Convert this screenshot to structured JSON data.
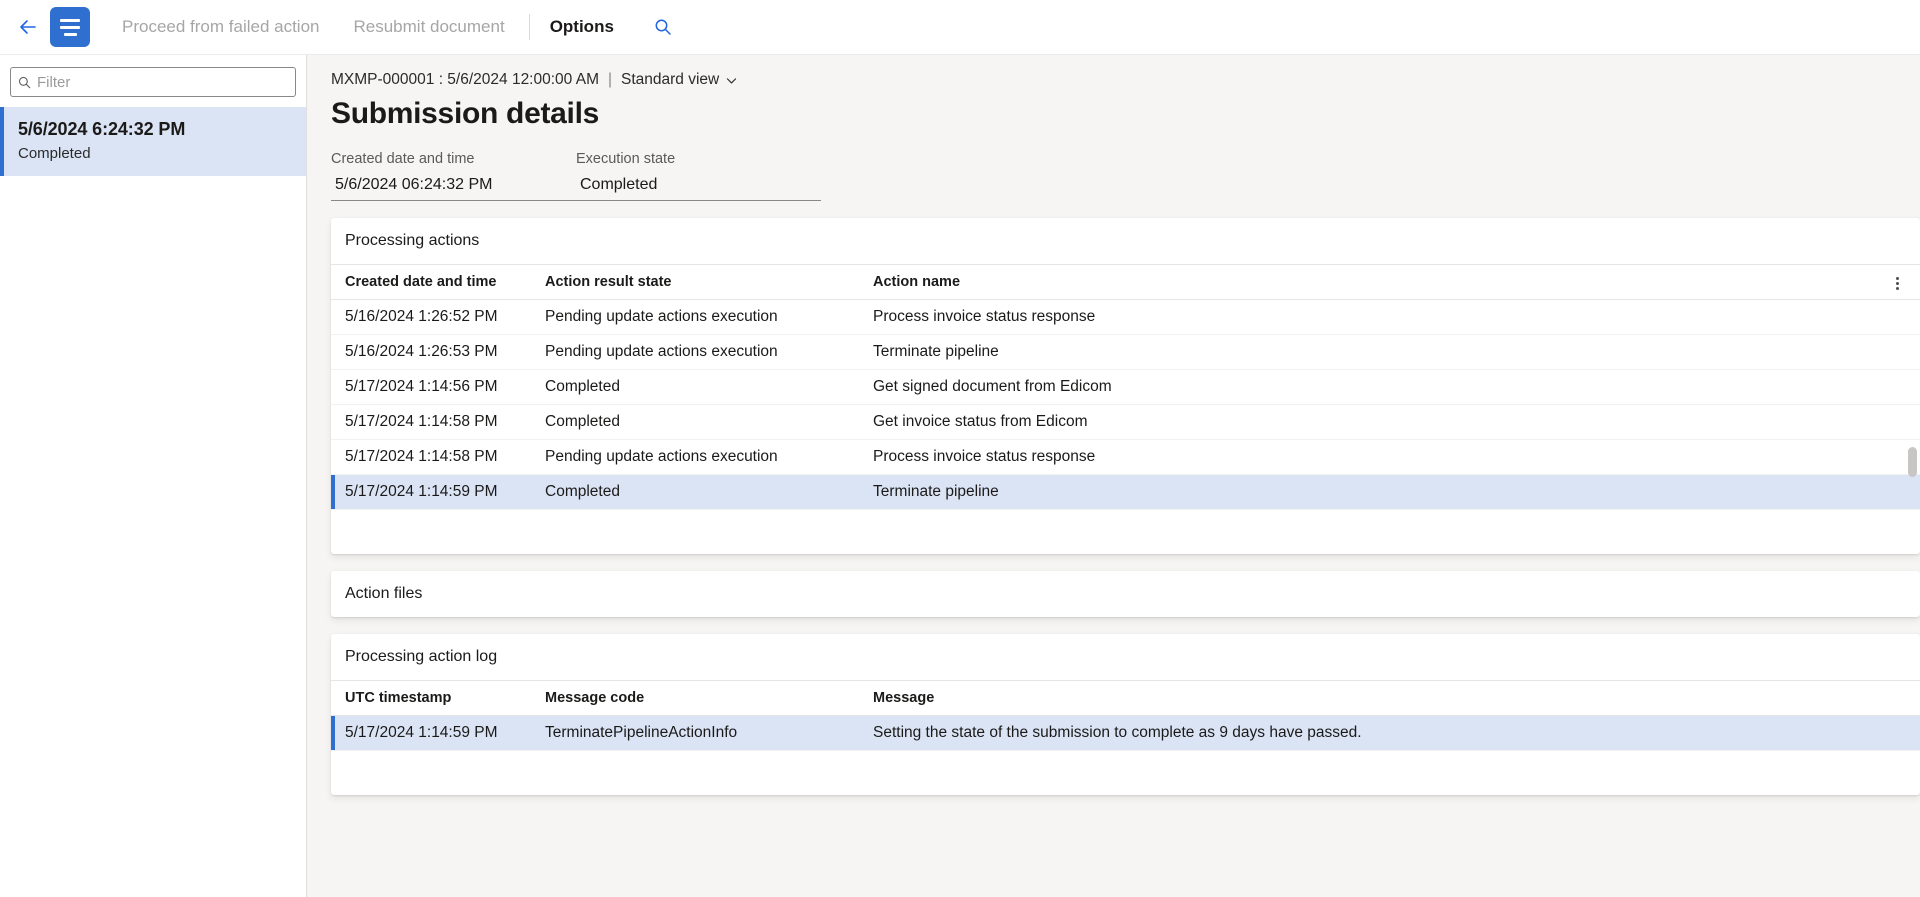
{
  "commandbar": {
    "back_icon": "back-arrow-icon",
    "menu_icon": "hamburger-menu-icon",
    "items": [
      {
        "label": "Proceed from failed action",
        "state": "disabled"
      },
      {
        "label": "Resubmit document",
        "state": "disabled"
      }
    ],
    "options_label": "Options",
    "search_icon": "search-icon"
  },
  "leftpane": {
    "filter": {
      "placeholder": "Filter",
      "value": "",
      "icon": "search-icon"
    },
    "items": [
      {
        "title": "5/6/2024 6:24:32 PM",
        "subtitle": "Completed",
        "selected": true
      }
    ]
  },
  "header": {
    "record_id": "MXMP-000001 : 5/6/2024 12:00:00 AM",
    "separator": "|",
    "view_name": "Standard view",
    "view_chevron_icon": "chevron-down-icon",
    "title": "Submission details"
  },
  "fields": {
    "created": {
      "label": "Created date and time",
      "value": "5/6/2024 06:24:32 PM"
    },
    "execution": {
      "label": "Execution state",
      "value": "Completed"
    }
  },
  "processing_actions": {
    "header": "Processing actions",
    "columns": [
      "Created date and time",
      "Action result state",
      "Action name"
    ],
    "kebab_icon": "more-options-icon",
    "rows": [
      {
        "date": "5/16/2024 1:26:52 PM",
        "state": "Pending update actions execution",
        "name": "Process invoice status response",
        "selected": false
      },
      {
        "date": "5/16/2024 1:26:53 PM",
        "state": "Pending update actions execution",
        "name": "Terminate pipeline",
        "selected": false
      },
      {
        "date": "5/17/2024 1:14:56 PM",
        "state": "Completed",
        "name": "Get signed document from Edicom",
        "selected": false
      },
      {
        "date": "5/17/2024 1:14:58 PM",
        "state": "Completed",
        "name": "Get invoice status from Edicom",
        "selected": false
      },
      {
        "date": "5/17/2024 1:14:58 PM",
        "state": "Pending update actions execution",
        "name": "Process invoice status response",
        "selected": false
      },
      {
        "date": "5/17/2024 1:14:59 PM",
        "state": "Completed",
        "name": "Terminate pipeline",
        "selected": true
      }
    ]
  },
  "action_files": {
    "header": "Action files"
  },
  "processing_action_log": {
    "header": "Processing action log",
    "columns": [
      "UTC timestamp",
      "Message code",
      "Message"
    ],
    "rows": [
      {
        "timestamp": "5/17/2024 1:14:59 PM",
        "code": "TerminatePipelineActionInfo",
        "message": "Setting the state of the submission to complete as 9 days have passed.",
        "selected": true
      }
    ]
  },
  "colors": {
    "accent": "#2f6fd0",
    "selection": "#dbe4f5",
    "page_bg": "#f6f5f4",
    "disabled_text": "#a6a6a6"
  }
}
